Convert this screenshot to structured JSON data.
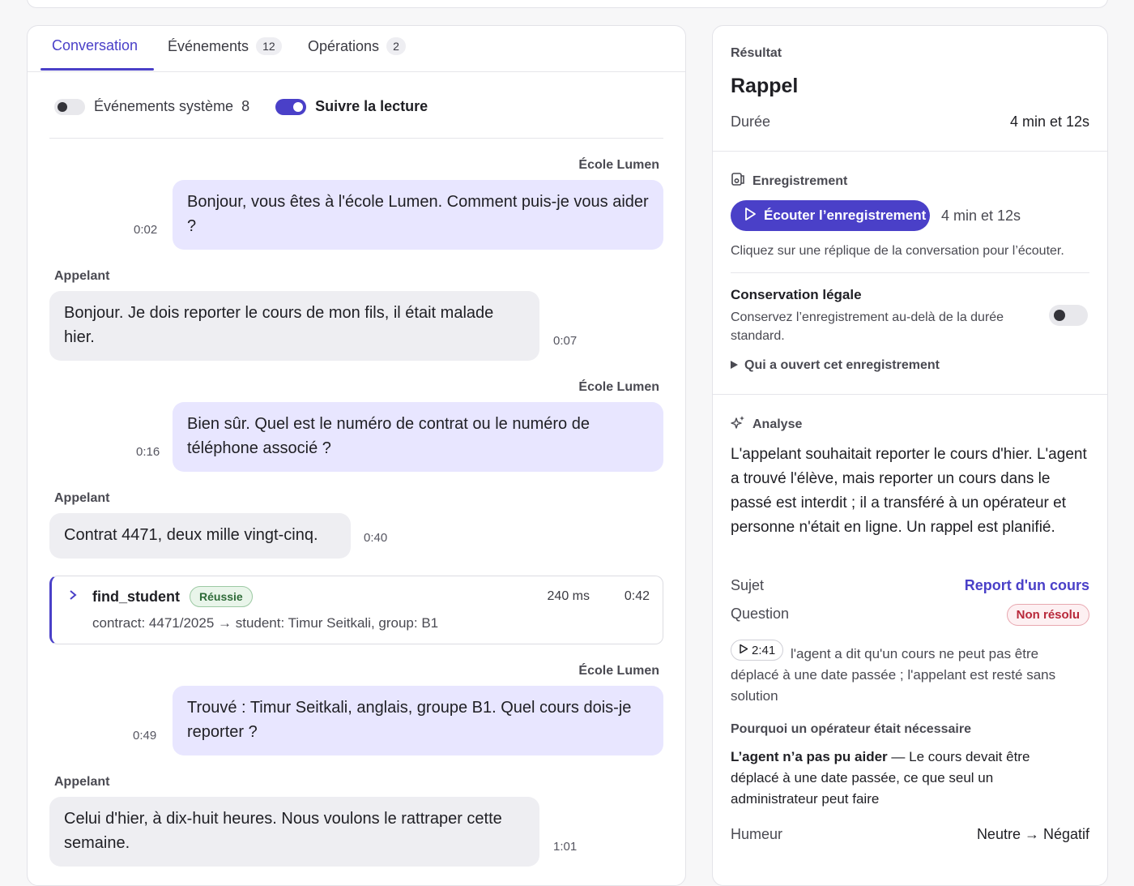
{
  "tabs": [
    {
      "label": "Conversation",
      "count": null
    },
    {
      "label": "Événements",
      "count": "12"
    },
    {
      "label": "Opérations",
      "count": "2"
    }
  ],
  "toggles": {
    "system_events_label": "Événements système",
    "system_events_count": "8",
    "system_events_on": false,
    "follow_label": "Suivre la lecture",
    "follow_on": true
  },
  "messages": [
    {
      "speaker": "École Lumen",
      "text": "Bonjour, vous êtes à l'école Lumen. Comment puis-je vous aider ?",
      "time": "0:02"
    },
    {
      "speaker": "Appelant",
      "text": "Bonjour. Je dois reporter le cours de mon fils, il était malade hier.",
      "time": "0:07"
    },
    {
      "speaker": "École Lumen",
      "text": "Bien sûr. Quel est le numéro de contrat ou le numéro de téléphone associé ?",
      "time": "0:16"
    },
    {
      "speaker": "Appelant",
      "text": "Contrat 4471, deux mille vingt-cinq.",
      "time": "0:40"
    },
    {
      "speaker": "École Lumen",
      "text": "Trouvé : Timur Seitkali, anglais, groupe B1. Quel cours dois-je reporter ?",
      "time": "0:49"
    },
    {
      "speaker": "Appelant",
      "text": "Celui d'hier, à dix-huit heures. Nous voulons le rattraper cette semaine.",
      "time": "1:01"
    }
  ],
  "tool_call": {
    "name": "find_student",
    "status": "Réussie",
    "duration": "240 ms",
    "time": "0:42",
    "detail": "contract: 4471/2025 → student: Timur Seitkali, group: B1"
  },
  "result": {
    "label": "Résultat",
    "value": "Rappel",
    "duration_label": "Durée",
    "duration_value": "4 min et 12s"
  },
  "recording": {
    "section_label": "Enregistrement",
    "play_label": "Écouter l’enregistrement",
    "length": "4 min et 12s",
    "hint": "Cliquez sur une réplique de la conversation pour l’écouter.",
    "legal_title": "Conservation légale",
    "legal_desc": "Conservez l’enregistrement au-delà de la durée standard.",
    "legal_on": false,
    "who_opened": "Qui a ouvert cet enregistrement"
  },
  "analysis": {
    "section_label": "Analyse",
    "summary": "L'appelant souhaitait reporter le cours d'hier. L'agent a trouvé l'élève, mais reporter un cours dans le passé est interdit ; il a transféré à un opérateur et personne n'était en ligne. Un rappel est planifié.",
    "subject_label": "Sujet",
    "subject_value": "Report d'un cours",
    "question_label": "Question",
    "question_status": "Non résolu",
    "quote_time": "2:41",
    "quote_text": "l'agent a dit qu'un cours ne peut pas être déplacé à une date passée ; l'appelant est resté sans solution",
    "why_heading": "Pourquoi un opérateur était nécessaire",
    "why_bold": "L’agent n’a pas pu aider",
    "why_text": " — Le cours devait être déplacé à une date passée, ce que seul un administrateur peut faire",
    "mood_label": "Humeur",
    "mood_value": "Neutre → Négatif"
  },
  "colors": {
    "accent": "#4a40c8",
    "agent_bubble": "#e8e6ff",
    "caller_bubble": "#eeeef2",
    "success": "#2e6b38",
    "danger": "#b8283a"
  }
}
